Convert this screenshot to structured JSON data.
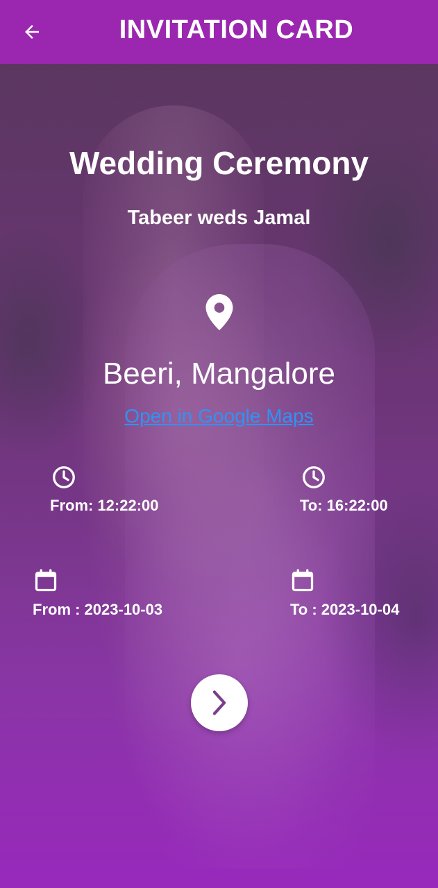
{
  "appbar": {
    "title": "INVITATION CARD",
    "back_icon": "arrow-left-icon"
  },
  "card": {
    "title": "Wedding Ceremony",
    "subtitle": "Tabeer weds Jamal",
    "location_icon": "location-pin-icon",
    "location": "Beeri, Mangalore",
    "maps_link": "Open in Google Maps",
    "time_from": "From: 12:22:00",
    "time_to": "To: 16:22:00",
    "date_from": "From : 2023-10-03",
    "date_to": "To : 2023-10-04",
    "next_icon": "chevron-right-icon"
  },
  "colors": {
    "appbar": "#9b27b0",
    "link": "#2f93f5",
    "next_chevron": "#7a3f8c"
  }
}
